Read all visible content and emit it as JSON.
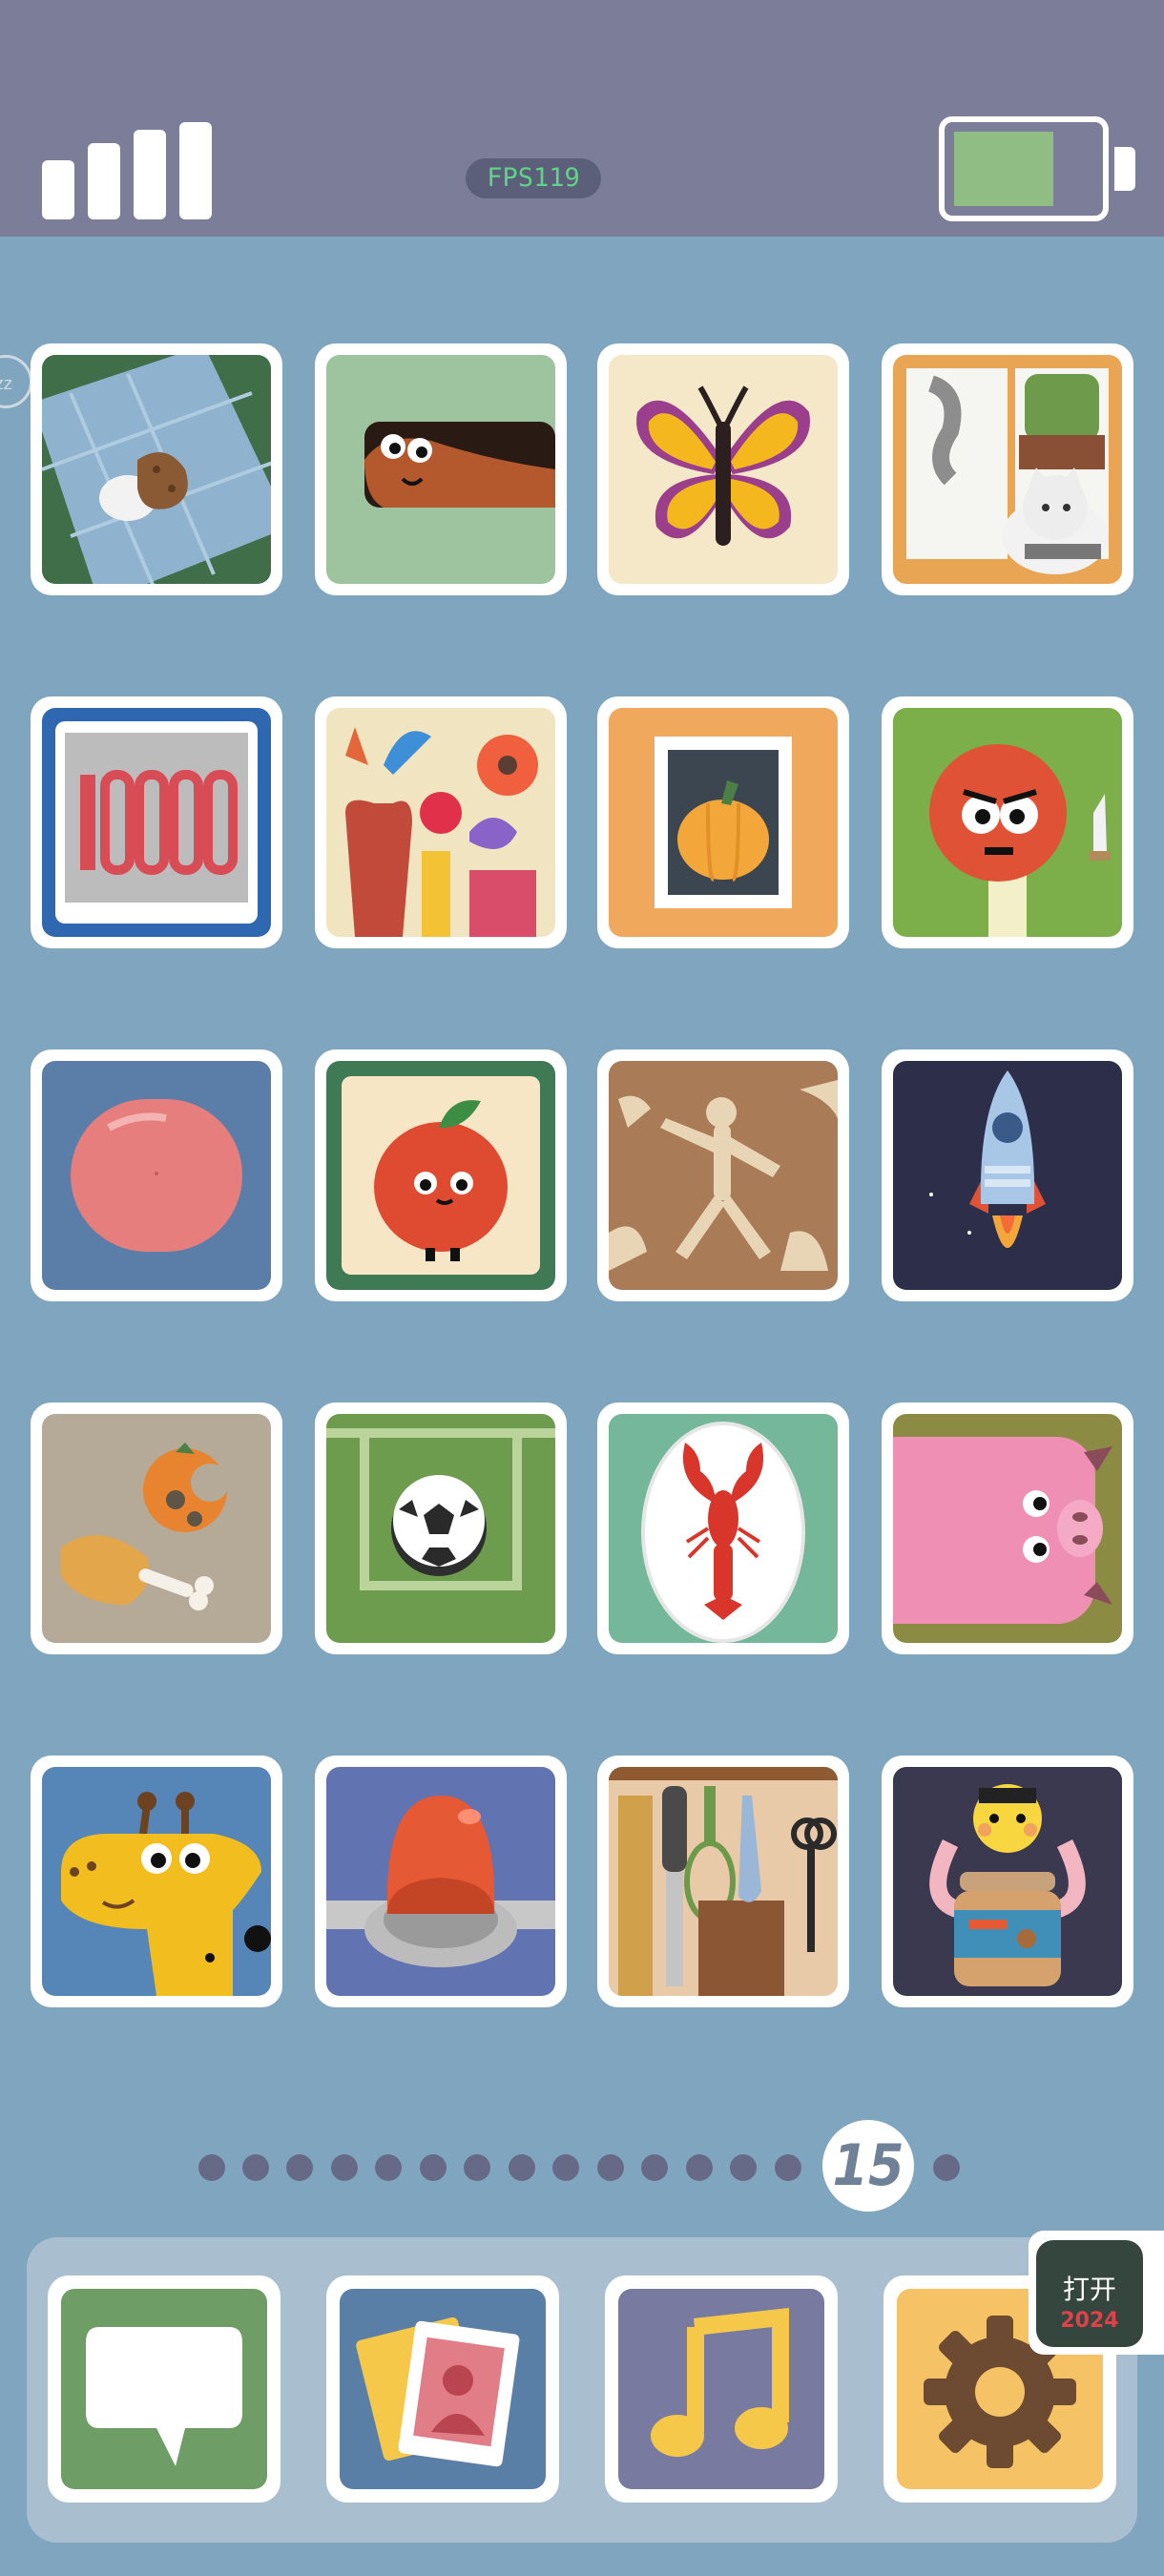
{
  "status_bar": {
    "fps_label": "FPS119",
    "signal_bars": 4,
    "battery_level": 0.8
  },
  "sleep_badge": "zz",
  "apps": [
    {
      "name": "cookie-on-napkin-icon",
      "bg": "#3f6e48"
    },
    {
      "name": "snake-peeking-icon",
      "bg": "#9dc39f"
    },
    {
      "name": "butterfly-icon",
      "bg": "#f4e8c8"
    },
    {
      "name": "cat-and-cactus-window-icon",
      "bg": "#e8a553"
    },
    {
      "name": "counter-10000-icon",
      "bg": "#2f67b0"
    },
    {
      "name": "flower-vases-icon",
      "bg": "#f1e4c0"
    },
    {
      "name": "pumpkin-stamp-icon",
      "bg": "#f0a85d"
    },
    {
      "name": "red-monster-with-knife-icon",
      "bg": "#7cae4a"
    },
    {
      "name": "pink-blob-icon",
      "bg": "#5b7ea8"
    },
    {
      "name": "tomato-character-icon",
      "bg": "#3f7a55"
    },
    {
      "name": "cave-drawing-icon",
      "bg": "#a97b56"
    },
    {
      "name": "rocket-icon",
      "bg": "#2d2e4a"
    },
    {
      "name": "orange-and-chicken-leftovers-icon",
      "bg": "#b5a997"
    },
    {
      "name": "soccer-ball-field-icon",
      "bg": "#6d9c4f"
    },
    {
      "name": "lobster-plate-icon",
      "bg": "#74b79b"
    },
    {
      "name": "pig-icon",
      "bg": "#8c8b43"
    },
    {
      "name": "giraffe-icon",
      "bg": "#5686b8"
    },
    {
      "name": "alarm-button-icon",
      "bg": "#6273b1"
    },
    {
      "name": "kitchen-utensils-icon",
      "bg": "#e8c9a8"
    },
    {
      "name": "bee-peanut-butter-jar-icon",
      "bg": "#3a3950"
    }
  ],
  "pager": {
    "total_pages": 16,
    "current_page": "15"
  },
  "dock": [
    {
      "name": "messages-icon",
      "bg": "#6e9e66"
    },
    {
      "name": "photos-icon",
      "bg": "#5a7fa6"
    },
    {
      "name": "music-icon",
      "bg": "#787b9f"
    },
    {
      "name": "settings-gear-icon",
      "bg": "#f5c265"
    }
  ],
  "floating_widget": {
    "label": "打开",
    "year": "2024"
  }
}
